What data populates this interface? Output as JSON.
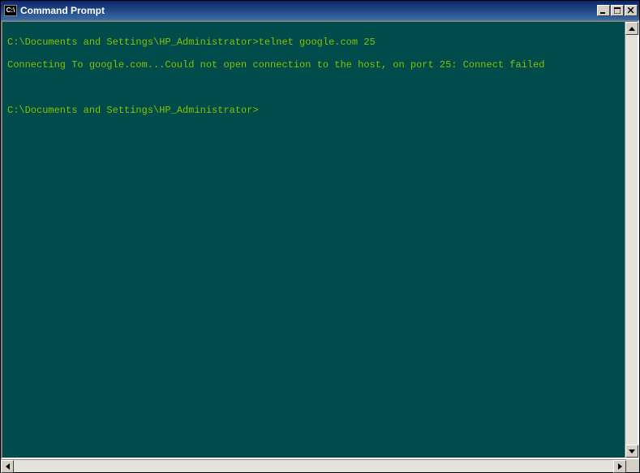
{
  "window": {
    "title": "Command Prompt",
    "icon_label": "C:\\"
  },
  "terminal": {
    "prompt_path": "C:\\Documents and Settings\\HP_Administrator>",
    "lines": [
      "C:\\Documents and Settings\\HP_Administrator>telnet google.com 25",
      "Connecting To google.com...Could not open connection to the host, on port 25: Connect failed",
      "",
      "C:\\Documents and Settings\\HP_Administrator>"
    ],
    "text_color": "#86c200",
    "background_color": "#004b4b"
  },
  "controls": {
    "minimize": "Minimize",
    "maximize": "Maximize",
    "close": "Close"
  }
}
